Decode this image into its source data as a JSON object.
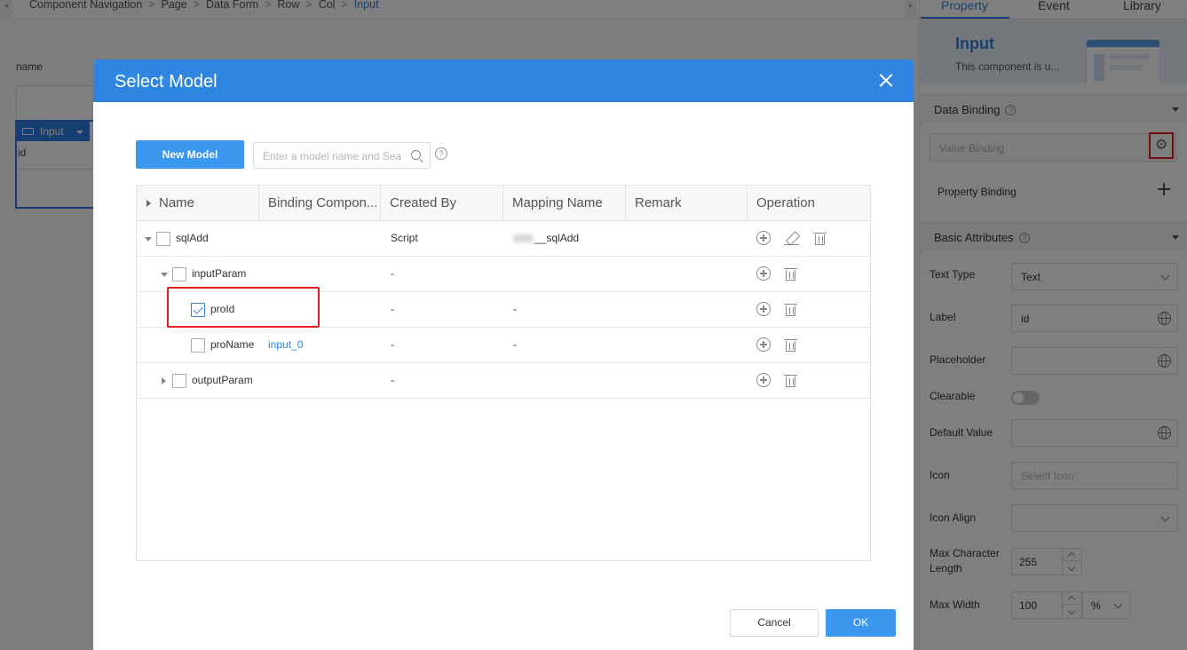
{
  "breadcrumb": [
    "Component Navigation",
    "Page",
    "Data Form",
    "Row",
    "Col",
    "Input"
  ],
  "canvas": {
    "name_label": "name",
    "input_tag": "Input",
    "id_label": "id"
  },
  "panel": {
    "tabs": [
      "Property",
      "Event",
      "Library"
    ],
    "component_title": "Input",
    "component_desc": "This component is u...",
    "data_binding": "Data Binding",
    "value_binding_placeholder": "Value Binding",
    "property_binding": "Property Binding",
    "basic_attributes": "Basic Attributes",
    "text_type_label": "Text Type",
    "text_type_value": "Text",
    "label_label": "Label",
    "label_value": "id",
    "placeholder_label": "Placeholder",
    "clearable_label": "Clearable",
    "default_value_label": "Default Value",
    "icon_label": "Icon",
    "icon_placeholder": "Select Icon",
    "icon_align_label": "Icon Align",
    "max_char_label_1": "Max Character",
    "max_char_label_2": "Length",
    "max_char_value": "255",
    "max_width_label": "Max Width",
    "max_width_value": "100",
    "max_width_unit": "%"
  },
  "modal": {
    "title": "Select Model",
    "new_model": "New Model",
    "search_placeholder": "Enter a model name and Sea",
    "columns": [
      "Name",
      "Binding Compon...",
      "Created By",
      "Mapping Name",
      "Remark",
      "Operation"
    ],
    "rows": [
      {
        "name": "sqlAdd",
        "binding": "",
        "created_by": "Script",
        "mapping": "__sqlAdd",
        "checked": false
      },
      {
        "name": "inputParam",
        "binding": "",
        "created_by": "-",
        "mapping": "",
        "checked": false
      },
      {
        "name": "proId",
        "binding": "",
        "created_by": "-",
        "mapping": "-",
        "checked": true
      },
      {
        "name": "proName",
        "binding": "input_0",
        "created_by": "-",
        "mapping": "-",
        "checked": false
      },
      {
        "name": "outputParam",
        "binding": "",
        "created_by": "-",
        "mapping": "",
        "checked": false
      }
    ],
    "cancel": "Cancel",
    "ok": "OK"
  },
  "colors": {
    "accent": "#2e86e0",
    "highlight": "#e02020"
  }
}
